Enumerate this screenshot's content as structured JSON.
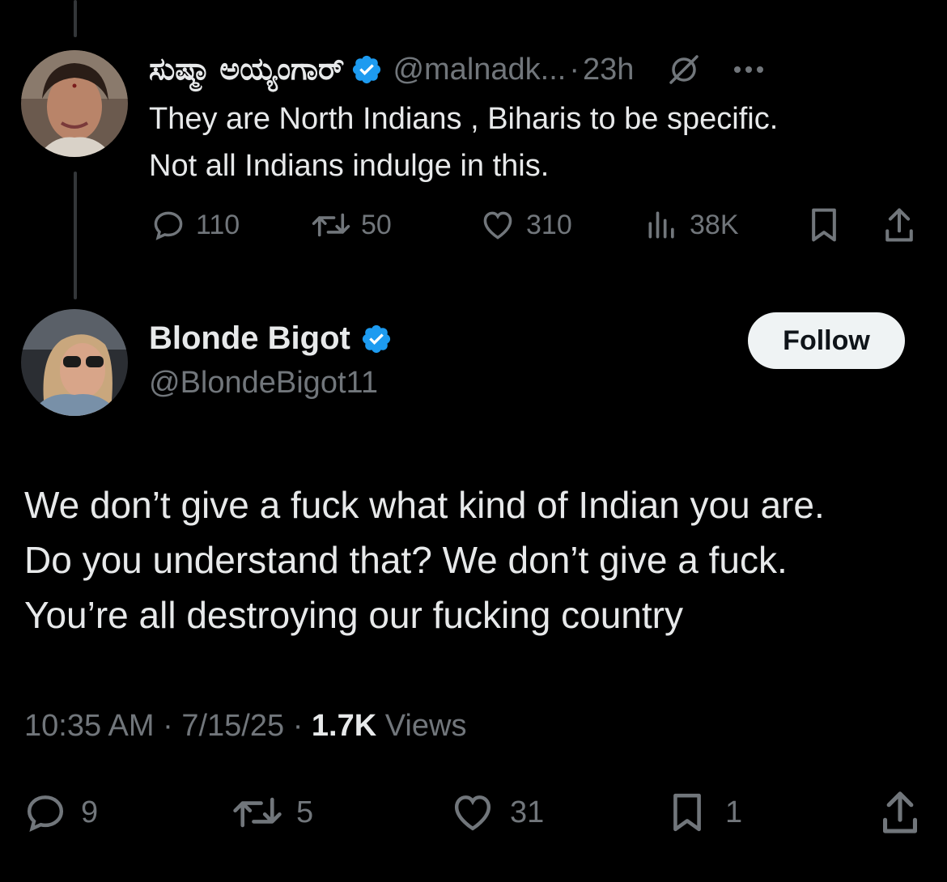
{
  "reply": {
    "display_name": "ಸುಷ್ಮಾ ಅಯ್ಯಂಗಾರ್",
    "handle": "@malnadk...",
    "separator": "·",
    "time": "23h",
    "text_line1": "They are North Indians , Biharis to be specific.",
    "text_line2": "Not all Indians indulge in this.",
    "stats": {
      "replies": "110",
      "reposts": "50",
      "likes": "310",
      "views": "38K"
    }
  },
  "main": {
    "display_name": "Blonde Bigot",
    "handle": "@BlondeBigot11",
    "follow_label": "Follow",
    "text_line1": "We don’t give a fuck what kind of Indian you are.",
    "text_line2": "Do you understand that? We don’t give a fuck.",
    "text_line3": "You’re all destroying our fucking country",
    "time": "10:35 AM",
    "date": "7/15/25",
    "views_count": "1.7K",
    "views_label": "Views",
    "stats": {
      "replies": "9",
      "reposts": "5",
      "likes": "31",
      "bookmarks": "1"
    }
  },
  "colors": {
    "background": "#000000",
    "text": "#e7e9ea",
    "muted": "#71767b",
    "verified": "#1d9bf0",
    "follow_bg": "#eff3f4"
  }
}
